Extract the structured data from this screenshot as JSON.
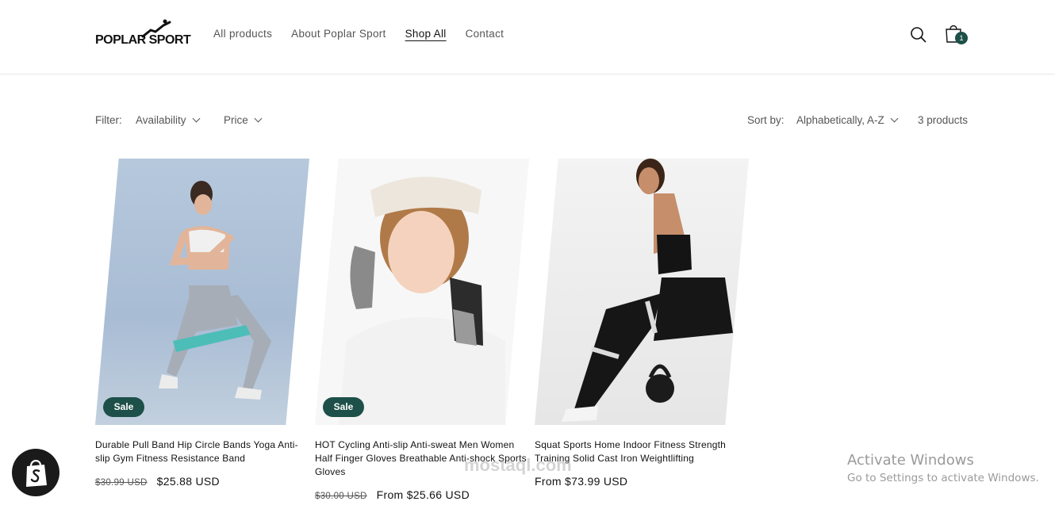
{
  "brand": {
    "logo_text": "POPLAR SPORT"
  },
  "nav": {
    "items": [
      {
        "label": "All products"
      },
      {
        "label": "About Poplar Sport"
      },
      {
        "label": "Shop All",
        "active": true
      },
      {
        "label": "Contact"
      }
    ]
  },
  "header": {
    "search_icon": "search-icon",
    "cart_icon": "cart-icon",
    "cart_count": "1"
  },
  "filters": {
    "label": "Filter:",
    "availability": "Availability",
    "price": "Price",
    "sort_label": "Sort by:",
    "sort_value": "Alphabetically, A-Z",
    "count": "3 products"
  },
  "products": [
    {
      "badge": "Sale",
      "title": "Durable Pull Band Hip Circle Bands Yoga Anti-slip Gym Fitness Resistance Band",
      "price_old": "$30.99 USD",
      "price": "$25.88 USD"
    },
    {
      "badge": "Sale",
      "title": "HOT Cycling Anti-slip Anti-sweat Men Women Half Finger Gloves Breathable Anti-shock Sports Gloves",
      "price_old": "$30.00 USD",
      "price": "From $25.66 USD"
    },
    {
      "badge": "",
      "title": "Squat Sports Home Indoor Fitness Strength Training Solid Cast Iron Weightlifting",
      "price_old": "",
      "price": "From $73.99 USD"
    }
  ],
  "overlay": {
    "activate_title": "Activate Windows",
    "activate_sub": "Go to Settings to activate Windows.",
    "watermark": "mostaql.com"
  },
  "colors": {
    "accent": "#1d5048",
    "text": "#121212",
    "muted": "#555555"
  }
}
